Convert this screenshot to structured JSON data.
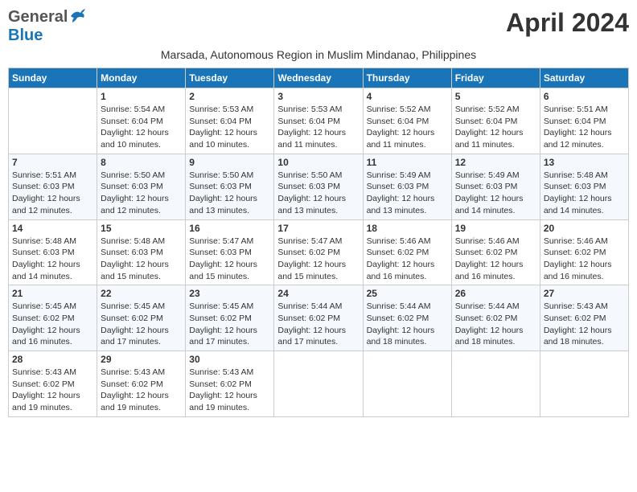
{
  "header": {
    "logo_general": "General",
    "logo_blue": "Blue",
    "main_title": "April 2024",
    "subtitle": "Marsada, Autonomous Region in Muslim Mindanao, Philippines"
  },
  "days_of_week": [
    "Sunday",
    "Monday",
    "Tuesday",
    "Wednesday",
    "Thursday",
    "Friday",
    "Saturday"
  ],
  "weeks": [
    [
      {
        "day": "",
        "info": ""
      },
      {
        "day": "1",
        "info": "Sunrise: 5:54 AM\nSunset: 6:04 PM\nDaylight: 12 hours\nand 10 minutes."
      },
      {
        "day": "2",
        "info": "Sunrise: 5:53 AM\nSunset: 6:04 PM\nDaylight: 12 hours\nand 10 minutes."
      },
      {
        "day": "3",
        "info": "Sunrise: 5:53 AM\nSunset: 6:04 PM\nDaylight: 12 hours\nand 11 minutes."
      },
      {
        "day": "4",
        "info": "Sunrise: 5:52 AM\nSunset: 6:04 PM\nDaylight: 12 hours\nand 11 minutes."
      },
      {
        "day": "5",
        "info": "Sunrise: 5:52 AM\nSunset: 6:04 PM\nDaylight: 12 hours\nand 11 minutes."
      },
      {
        "day": "6",
        "info": "Sunrise: 5:51 AM\nSunset: 6:04 PM\nDaylight: 12 hours\nand 12 minutes."
      }
    ],
    [
      {
        "day": "7",
        "info": "Sunrise: 5:51 AM\nSunset: 6:03 PM\nDaylight: 12 hours\nand 12 minutes."
      },
      {
        "day": "8",
        "info": "Sunrise: 5:50 AM\nSunset: 6:03 PM\nDaylight: 12 hours\nand 12 minutes."
      },
      {
        "day": "9",
        "info": "Sunrise: 5:50 AM\nSunset: 6:03 PM\nDaylight: 12 hours\nand 13 minutes."
      },
      {
        "day": "10",
        "info": "Sunrise: 5:50 AM\nSunset: 6:03 PM\nDaylight: 12 hours\nand 13 minutes."
      },
      {
        "day": "11",
        "info": "Sunrise: 5:49 AM\nSunset: 6:03 PM\nDaylight: 12 hours\nand 13 minutes."
      },
      {
        "day": "12",
        "info": "Sunrise: 5:49 AM\nSunset: 6:03 PM\nDaylight: 12 hours\nand 14 minutes."
      },
      {
        "day": "13",
        "info": "Sunrise: 5:48 AM\nSunset: 6:03 PM\nDaylight: 12 hours\nand 14 minutes."
      }
    ],
    [
      {
        "day": "14",
        "info": "Sunrise: 5:48 AM\nSunset: 6:03 PM\nDaylight: 12 hours\nand 14 minutes."
      },
      {
        "day": "15",
        "info": "Sunrise: 5:48 AM\nSunset: 6:03 PM\nDaylight: 12 hours\nand 15 minutes."
      },
      {
        "day": "16",
        "info": "Sunrise: 5:47 AM\nSunset: 6:03 PM\nDaylight: 12 hours\nand 15 minutes."
      },
      {
        "day": "17",
        "info": "Sunrise: 5:47 AM\nSunset: 6:02 PM\nDaylight: 12 hours\nand 15 minutes."
      },
      {
        "day": "18",
        "info": "Sunrise: 5:46 AM\nSunset: 6:02 PM\nDaylight: 12 hours\nand 16 minutes."
      },
      {
        "day": "19",
        "info": "Sunrise: 5:46 AM\nSunset: 6:02 PM\nDaylight: 12 hours\nand 16 minutes."
      },
      {
        "day": "20",
        "info": "Sunrise: 5:46 AM\nSunset: 6:02 PM\nDaylight: 12 hours\nand 16 minutes."
      }
    ],
    [
      {
        "day": "21",
        "info": "Sunrise: 5:45 AM\nSunset: 6:02 PM\nDaylight: 12 hours\nand 16 minutes."
      },
      {
        "day": "22",
        "info": "Sunrise: 5:45 AM\nSunset: 6:02 PM\nDaylight: 12 hours\nand 17 minutes."
      },
      {
        "day": "23",
        "info": "Sunrise: 5:45 AM\nSunset: 6:02 PM\nDaylight: 12 hours\nand 17 minutes."
      },
      {
        "day": "24",
        "info": "Sunrise: 5:44 AM\nSunset: 6:02 PM\nDaylight: 12 hours\nand 17 minutes."
      },
      {
        "day": "25",
        "info": "Sunrise: 5:44 AM\nSunset: 6:02 PM\nDaylight: 12 hours\nand 18 minutes."
      },
      {
        "day": "26",
        "info": "Sunrise: 5:44 AM\nSunset: 6:02 PM\nDaylight: 12 hours\nand 18 minutes."
      },
      {
        "day": "27",
        "info": "Sunrise: 5:43 AM\nSunset: 6:02 PM\nDaylight: 12 hours\nand 18 minutes."
      }
    ],
    [
      {
        "day": "28",
        "info": "Sunrise: 5:43 AM\nSunset: 6:02 PM\nDaylight: 12 hours\nand 19 minutes."
      },
      {
        "day": "29",
        "info": "Sunrise: 5:43 AM\nSunset: 6:02 PM\nDaylight: 12 hours\nand 19 minutes."
      },
      {
        "day": "30",
        "info": "Sunrise: 5:43 AM\nSunset: 6:02 PM\nDaylight: 12 hours\nand 19 minutes."
      },
      {
        "day": "",
        "info": ""
      },
      {
        "day": "",
        "info": ""
      },
      {
        "day": "",
        "info": ""
      },
      {
        "day": "",
        "info": ""
      }
    ]
  ]
}
